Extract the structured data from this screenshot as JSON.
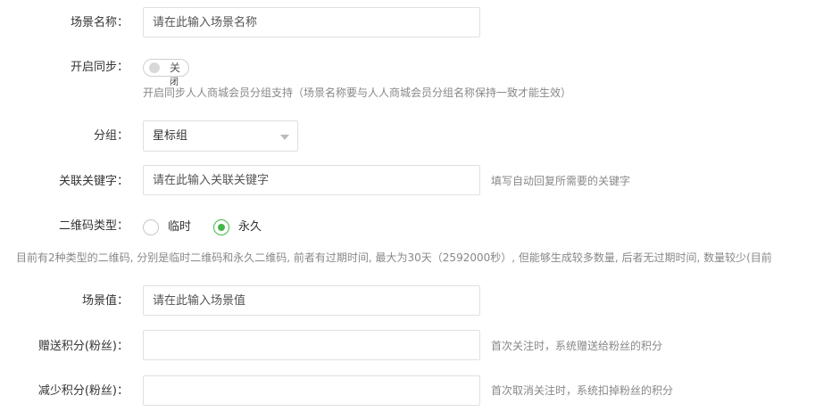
{
  "scene_name": {
    "label": "场景名称：",
    "placeholder": "请在此输入场景名称",
    "value": ""
  },
  "sync": {
    "label": "开启同步：",
    "toggle_text": "关",
    "toggle_on": false,
    "cursor_glyph": "闭",
    "help": "开启同步人人商城会员分组支持（场景名称要与人人商城会员分组名称保持一致才能生效）"
  },
  "group": {
    "label": "分组：",
    "selected": "星标组"
  },
  "keyword": {
    "label": "关联关键字：",
    "placeholder": "请在此输入关联关键字",
    "value": "",
    "help": "填写自动回复所需要的关键字"
  },
  "qr_type": {
    "label": "二维码类型：",
    "options": [
      {
        "label": "临时",
        "checked": false
      },
      {
        "label": "永久",
        "checked": true
      }
    ],
    "note": "目前有2种类型的二维码, 分别是临时二维码和永久二维码, 前者有过期时间, 最大为30天（2592000秒）, 但能够生成较多数量, 后者无过期时间, 数量较少(目前"
  },
  "scene_value": {
    "label": "场景值：",
    "placeholder": "请在此输入场景值",
    "value": ""
  },
  "gift_points": {
    "label": "赠送积分(粉丝)：",
    "value": "",
    "help": "首次关注时，系统赠送给粉丝的积分"
  },
  "reduce_points": {
    "label": "减少积分(粉丝)：",
    "value": "",
    "help": "首次取消关注时，系统扣掉粉丝的积分"
  },
  "colors": {
    "accent": "#44b549",
    "border": "#e0e0e0",
    "help_text": "#888888"
  }
}
